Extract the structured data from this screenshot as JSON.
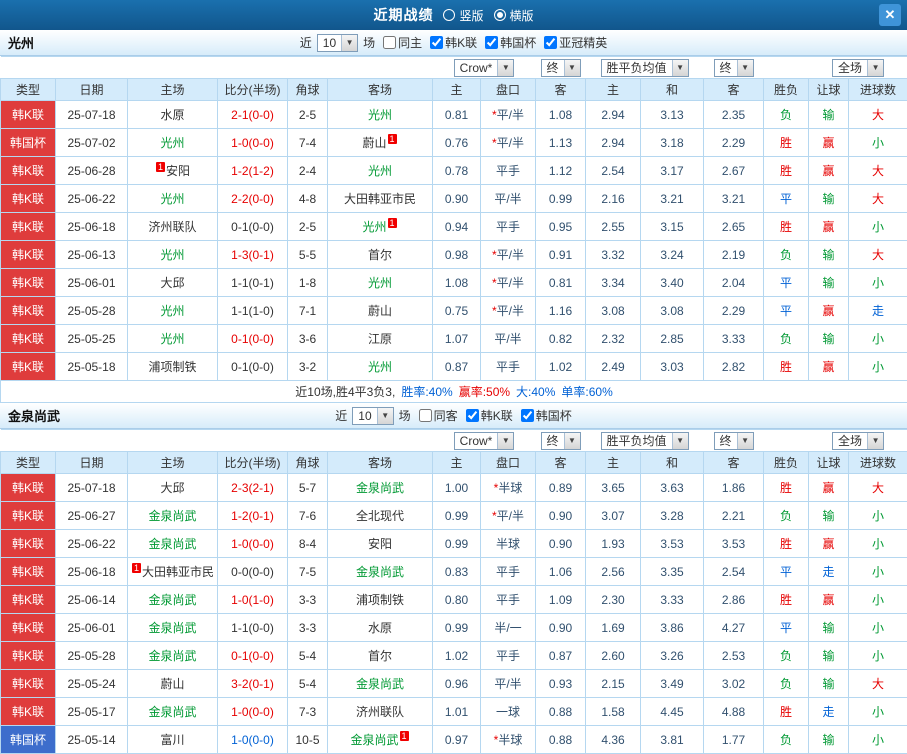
{
  "titlebar": {
    "title": "近期战绩",
    "radios": [
      {
        "label": "竖版",
        "selected": false
      },
      {
        "label": "横版",
        "selected": true
      }
    ],
    "close_label": "✕"
  },
  "red_card_label": "1",
  "table_head": {
    "static": [
      "类型",
      "日期",
      "主场",
      "比分(半场)",
      "角球",
      "客场"
    ],
    "asian_sub": [
      "主",
      "盘口",
      "客"
    ],
    "europe_sub": [
      "主",
      "和",
      "客"
    ],
    "result_sub": [
      "胜负",
      "让球",
      "进球数"
    ]
  },
  "controls": {
    "bookmaker": "Crow*",
    "final_asian": "终",
    "average": "胜平负均值",
    "final_europe": "终",
    "scope": "全场"
  },
  "sections": [
    {
      "team": "光州",
      "filter": {
        "near": "近",
        "count": "10",
        "games": "场",
        "checks": [
          {
            "label": "同主",
            "on": false
          },
          {
            "label": "韩K联",
            "on": true
          },
          {
            "label": "韩国杯",
            "on": true
          },
          {
            "label": "亚冠精英",
            "on": true
          }
        ]
      },
      "rows": [
        {
          "league": "韩K联",
          "league_color": "red",
          "date": "25-07-18",
          "home": "水原",
          "home_focal": false,
          "home_rc": null,
          "score": "2-1(0-0)",
          "score_color": "red",
          "corners": "2-5",
          "away": "光州",
          "away_focal": true,
          "away_rc": null,
          "asian": [
            "0.81",
            "*平/半",
            "1.08"
          ],
          "europe": [
            "2.94",
            "3.13",
            "2.35"
          ],
          "results": [
            [
              "负",
              "green"
            ],
            [
              "输",
              "green"
            ],
            [
              "大",
              "red"
            ]
          ]
        },
        {
          "league": "韩国杯",
          "league_color": "red",
          "date": "25-07-02",
          "home": "光州",
          "home_focal": true,
          "home_rc": null,
          "score": "1-0(0-0)",
          "score_color": "red",
          "corners": "7-4",
          "away": "蔚山",
          "away_focal": false,
          "away_rc": "after",
          "asian": [
            "0.76",
            "*平/半",
            "1.13"
          ],
          "europe": [
            "2.94",
            "3.18",
            "2.29"
          ],
          "results": [
            [
              "胜",
              "red"
            ],
            [
              "赢",
              "red"
            ],
            [
              "小",
              "green"
            ]
          ]
        },
        {
          "league": "韩K联",
          "league_color": "red",
          "date": "25-06-28",
          "home": "安阳",
          "home_focal": false,
          "home_rc": "before",
          "score": "1-2(1-2)",
          "score_color": "red",
          "corners": "2-4",
          "away": "光州",
          "away_focal": true,
          "away_rc": null,
          "asian": [
            "0.78",
            "平手",
            "1.12"
          ],
          "europe": [
            "2.54",
            "3.17",
            "2.67"
          ],
          "results": [
            [
              "胜",
              "red"
            ],
            [
              "赢",
              "red"
            ],
            [
              "大",
              "red"
            ]
          ]
        },
        {
          "league": "韩K联",
          "league_color": "red",
          "date": "25-06-22",
          "home": "光州",
          "home_focal": true,
          "home_rc": null,
          "score": "2-2(0-0)",
          "score_color": "red",
          "corners": "4-8",
          "away": "大田韩亚市民",
          "away_focal": false,
          "away_rc": null,
          "asian": [
            "0.90",
            "平/半",
            "0.99"
          ],
          "europe": [
            "2.16",
            "3.21",
            "3.21"
          ],
          "results": [
            [
              "平",
              "blue"
            ],
            [
              "输",
              "green"
            ],
            [
              "大",
              "red"
            ]
          ]
        },
        {
          "league": "韩K联",
          "league_color": "red",
          "date": "25-06-18",
          "home": "济州联队",
          "home_focal": false,
          "home_rc": null,
          "score": "0-1(0-0)",
          "score_color": "dark",
          "corners": "2-5",
          "away": "光州",
          "away_focal": true,
          "away_rc": "after",
          "asian": [
            "0.94",
            "平手",
            "0.95"
          ],
          "europe": [
            "2.55",
            "3.15",
            "2.65"
          ],
          "results": [
            [
              "胜",
              "red"
            ],
            [
              "赢",
              "red"
            ],
            [
              "小",
              "green"
            ]
          ]
        },
        {
          "league": "韩K联",
          "league_color": "red",
          "date": "25-06-13",
          "home": "光州",
          "home_focal": true,
          "home_rc": null,
          "score": "1-3(0-1)",
          "score_color": "red",
          "corners": "5-5",
          "away": "首尔",
          "away_focal": false,
          "away_rc": null,
          "asian": [
            "0.98",
            "*平/半",
            "0.91"
          ],
          "europe": [
            "3.32",
            "3.24",
            "2.19"
          ],
          "results": [
            [
              "负",
              "green"
            ],
            [
              "输",
              "green"
            ],
            [
              "大",
              "red"
            ]
          ]
        },
        {
          "league": "韩K联",
          "league_color": "red",
          "date": "25-06-01",
          "home": "大邱",
          "home_focal": false,
          "home_rc": null,
          "score": "1-1(0-1)",
          "score_color": "dark",
          "corners": "1-8",
          "away": "光州",
          "away_focal": true,
          "away_rc": null,
          "asian": [
            "1.08",
            "*平/半",
            "0.81"
          ],
          "europe": [
            "3.34",
            "3.40",
            "2.04"
          ],
          "results": [
            [
              "平",
              "blue"
            ],
            [
              "输",
              "green"
            ],
            [
              "小",
              "green"
            ]
          ]
        },
        {
          "league": "韩K联",
          "league_color": "red",
          "date": "25-05-28",
          "home": "光州",
          "home_focal": true,
          "home_rc": null,
          "score": "1-1(1-0)",
          "score_color": "dark",
          "corners": "7-1",
          "away": "蔚山",
          "away_focal": false,
          "away_rc": null,
          "asian": [
            "0.75",
            "*平/半",
            "1.16"
          ],
          "europe": [
            "3.08",
            "3.08",
            "2.29"
          ],
          "results": [
            [
              "平",
              "blue"
            ],
            [
              "赢",
              "red"
            ],
            [
              "走",
              "blue"
            ]
          ]
        },
        {
          "league": "韩K联",
          "league_color": "red",
          "date": "25-05-25",
          "home": "光州",
          "home_focal": true,
          "home_rc": null,
          "score": "0-1(0-0)",
          "score_color": "red",
          "corners": "3-6",
          "away": "江原",
          "away_focal": false,
          "away_rc": null,
          "asian": [
            "1.07",
            "平/半",
            "0.82"
          ],
          "europe": [
            "2.32",
            "2.85",
            "3.33"
          ],
          "results": [
            [
              "负",
              "green"
            ],
            [
              "输",
              "green"
            ],
            [
              "小",
              "green"
            ]
          ]
        },
        {
          "league": "韩K联",
          "league_color": "red",
          "date": "25-05-18",
          "home": "浦项制铁",
          "home_focal": false,
          "home_rc": null,
          "score": "0-1(0-0)",
          "score_color": "dark",
          "corners": "3-2",
          "away": "光州",
          "away_focal": true,
          "away_rc": null,
          "asian": [
            "0.87",
            "平手",
            "1.02"
          ],
          "europe": [
            "2.49",
            "3.03",
            "2.82"
          ],
          "results": [
            [
              "胜",
              "red"
            ],
            [
              "赢",
              "red"
            ],
            [
              "小",
              "green"
            ]
          ]
        }
      ],
      "summary": [
        {
          "t": "近10场,胜4平3负3,",
          "c": "dark"
        },
        {
          "t": "胜率:40%",
          "c": "blue"
        },
        {
          "t": "赢率:50%",
          "c": "red"
        },
        {
          "t": "大:40%",
          "c": "blue"
        },
        {
          "t": "单率:60%",
          "c": "blue"
        }
      ]
    },
    {
      "team": "金泉尚武",
      "filter": {
        "near": "近",
        "count": "10",
        "games": "场",
        "checks": [
          {
            "label": "同客",
            "on": false
          },
          {
            "label": "韩K联",
            "on": true
          },
          {
            "label": "韩国杯",
            "on": true
          }
        ]
      },
      "rows": [
        {
          "league": "韩K联",
          "league_color": "red",
          "date": "25-07-18",
          "home": "大邱",
          "home_focal": false,
          "home_rc": null,
          "score": "2-3(2-1)",
          "score_color": "red",
          "corners": "5-7",
          "away": "金泉尚武",
          "away_focal": true,
          "away_rc": null,
          "asian": [
            "1.00",
            "*半球",
            "0.89"
          ],
          "europe": [
            "3.65",
            "3.63",
            "1.86"
          ],
          "results": [
            [
              "胜",
              "red"
            ],
            [
              "赢",
              "red"
            ],
            [
              "大",
              "red"
            ]
          ]
        },
        {
          "league": "韩K联",
          "league_color": "red",
          "date": "25-06-27",
          "home": "金泉尚武",
          "home_focal": true,
          "home_rc": null,
          "score": "1-2(0-1)",
          "score_color": "red",
          "corners": "7-6",
          "away": "全北现代",
          "away_focal": false,
          "away_rc": null,
          "asian": [
            "0.99",
            "*平/半",
            "0.90"
          ],
          "europe": [
            "3.07",
            "3.28",
            "2.21"
          ],
          "results": [
            [
              "负",
              "green"
            ],
            [
              "输",
              "green"
            ],
            [
              "小",
              "green"
            ]
          ]
        },
        {
          "league": "韩K联",
          "league_color": "red",
          "date": "25-06-22",
          "home": "金泉尚武",
          "home_focal": true,
          "home_rc": null,
          "score": "1-0(0-0)",
          "score_color": "red",
          "corners": "8-4",
          "away": "安阳",
          "away_focal": false,
          "away_rc": null,
          "asian": [
            "0.99",
            "半球",
            "0.90"
          ],
          "europe": [
            "1.93",
            "3.53",
            "3.53"
          ],
          "results": [
            [
              "胜",
              "red"
            ],
            [
              "赢",
              "red"
            ],
            [
              "小",
              "green"
            ]
          ]
        },
        {
          "league": "韩K联",
          "league_color": "red",
          "date": "25-06-18",
          "home": "大田韩亚市民",
          "home_focal": false,
          "home_rc": "before",
          "score": "0-0(0-0)",
          "score_color": "dark",
          "corners": "7-5",
          "away": "金泉尚武",
          "away_focal": true,
          "away_rc": null,
          "asian": [
            "0.83",
            "平手",
            "1.06"
          ],
          "europe": [
            "2.56",
            "3.35",
            "2.54"
          ],
          "results": [
            [
              "平",
              "blue"
            ],
            [
              "走",
              "blue"
            ],
            [
              "小",
              "green"
            ]
          ]
        },
        {
          "league": "韩K联",
          "league_color": "red",
          "date": "25-06-14",
          "home": "金泉尚武",
          "home_focal": true,
          "home_rc": null,
          "score": "1-0(1-0)",
          "score_color": "red",
          "corners": "3-3",
          "away": "浦项制铁",
          "away_focal": false,
          "away_rc": null,
          "asian": [
            "0.80",
            "平手",
            "1.09"
          ],
          "europe": [
            "2.30",
            "3.33",
            "2.86"
          ],
          "results": [
            [
              "胜",
              "red"
            ],
            [
              "赢",
              "red"
            ],
            [
              "小",
              "green"
            ]
          ]
        },
        {
          "league": "韩K联",
          "league_color": "red",
          "date": "25-06-01",
          "home": "金泉尚武",
          "home_focal": true,
          "home_rc": null,
          "score": "1-1(0-0)",
          "score_color": "dark",
          "corners": "3-3",
          "away": "水原",
          "away_focal": false,
          "away_rc": null,
          "asian": [
            "0.99",
            "半/一",
            "0.90"
          ],
          "europe": [
            "1.69",
            "3.86",
            "4.27"
          ],
          "results": [
            [
              "平",
              "blue"
            ],
            [
              "输",
              "green"
            ],
            [
              "小",
              "green"
            ]
          ]
        },
        {
          "league": "韩K联",
          "league_color": "red",
          "date": "25-05-28",
          "home": "金泉尚武",
          "home_focal": true,
          "home_rc": null,
          "score": "0-1(0-0)",
          "score_color": "red",
          "corners": "5-4",
          "away": "首尔",
          "away_focal": false,
          "away_rc": null,
          "asian": [
            "1.02",
            "平手",
            "0.87"
          ],
          "europe": [
            "2.60",
            "3.26",
            "2.53"
          ],
          "results": [
            [
              "负",
              "green"
            ],
            [
              "输",
              "green"
            ],
            [
              "小",
              "green"
            ]
          ]
        },
        {
          "league": "韩K联",
          "league_color": "red",
          "date": "25-05-24",
          "home": "蔚山",
          "home_focal": false,
          "home_rc": null,
          "score": "3-2(0-1)",
          "score_color": "red",
          "corners": "5-4",
          "away": "金泉尚武",
          "away_focal": true,
          "away_rc": null,
          "asian": [
            "0.96",
            "平/半",
            "0.93"
          ],
          "europe": [
            "2.15",
            "3.49",
            "3.02"
          ],
          "results": [
            [
              "负",
              "green"
            ],
            [
              "输",
              "green"
            ],
            [
              "大",
              "red"
            ]
          ]
        },
        {
          "league": "韩K联",
          "league_color": "red",
          "date": "25-05-17",
          "home": "金泉尚武",
          "home_focal": true,
          "home_rc": null,
          "score": "1-0(0-0)",
          "score_color": "red",
          "corners": "7-3",
          "away": "济州联队",
          "away_focal": false,
          "away_rc": null,
          "asian": [
            "1.01",
            "一球",
            "0.88"
          ],
          "europe": [
            "1.58",
            "4.45",
            "4.88"
          ],
          "results": [
            [
              "胜",
              "red"
            ],
            [
              "走",
              "blue"
            ],
            [
              "小",
              "green"
            ]
          ]
        },
        {
          "league": "韩国杯",
          "league_color": "blue",
          "date": "25-05-14",
          "home": "富川",
          "home_focal": false,
          "home_rc": null,
          "score": "1-0(0-0)",
          "score_color": "blue",
          "corners": "10-5",
          "away": "金泉尚武",
          "away_focal": true,
          "away_rc": "after",
          "asian": [
            "0.97",
            "*半球",
            "0.88"
          ],
          "europe": [
            "4.36",
            "3.81",
            "1.77"
          ],
          "results": [
            [
              "负",
              "green"
            ],
            [
              "输",
              "green"
            ],
            [
              "小",
              "green"
            ]
          ]
        }
      ],
      "summary": null
    }
  ]
}
